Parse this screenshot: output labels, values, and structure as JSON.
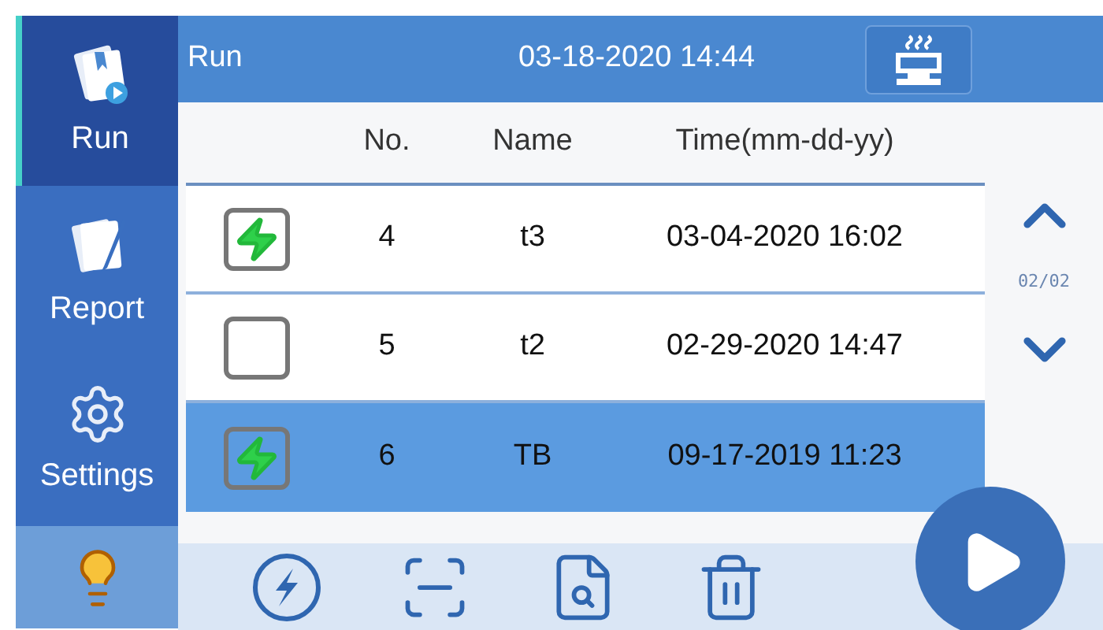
{
  "sidebar": {
    "items": [
      {
        "kind": "run",
        "label": "Run",
        "selected": true
      },
      {
        "kind": "report",
        "label": "Report",
        "selected": false
      },
      {
        "kind": "settings",
        "label": "Settings",
        "selected": false
      },
      {
        "kind": "tip",
        "selected": false
      }
    ]
  },
  "header": {
    "title": "Run",
    "datetime": "03-18-2020 14:44"
  },
  "table": {
    "columns": [
      "No.",
      "Name",
      "Time(mm-dd-yy)"
    ],
    "rows": [
      {
        "checked": true,
        "selected": false,
        "no": "4",
        "name": "t3",
        "time": "03-04-2020 16:02"
      },
      {
        "checked": false,
        "selected": false,
        "no": "5",
        "name": "t2",
        "time": "02-29-2020 14:47"
      },
      {
        "checked": true,
        "selected": true,
        "no": "6",
        "name": "TB",
        "time": "09-17-2019 11:23"
      }
    ]
  },
  "pager": {
    "page": "02/02"
  },
  "toolbar": {
    "buttons": [
      {
        "kind": "flash"
      },
      {
        "kind": "scan"
      },
      {
        "kind": "search"
      },
      {
        "kind": "delete"
      }
    ]
  }
}
